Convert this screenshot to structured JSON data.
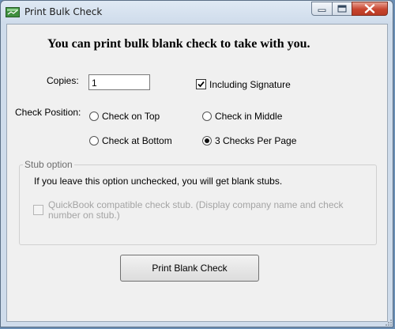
{
  "window": {
    "title": "Print Bulk Check",
    "controls": {
      "minimize_icon": "minimize-icon",
      "maximize_icon": "maximize-icon",
      "close_icon": "close-icon"
    }
  },
  "heading": "You can print bulk blank check to take with you.",
  "copies": {
    "label": "Copies:",
    "value": "1"
  },
  "signature": {
    "label": "Including Signature",
    "checked": true
  },
  "check_position": {
    "label": "Check Position:",
    "options": [
      {
        "label": "Check on Top",
        "selected": false
      },
      {
        "label": "Check in Middle",
        "selected": false
      },
      {
        "label": "Check at Bottom",
        "selected": false
      },
      {
        "label": "3 Checks Per Page",
        "selected": true
      }
    ]
  },
  "stub": {
    "legend": "Stub option",
    "info": "If you leave this option unchecked, you will get blank stubs.",
    "quickbook_line1": "QuickBook compatible check stub. (Display company name and check",
    "quickbook_line2": "number on stub.)",
    "quickbook_checked": false,
    "quickbook_enabled": false
  },
  "print_button": "Print Blank Check",
  "colors": {
    "close_button": "#c8452f",
    "client_bg": "#f0f0f0",
    "title_bar": "#dfe9f4"
  }
}
